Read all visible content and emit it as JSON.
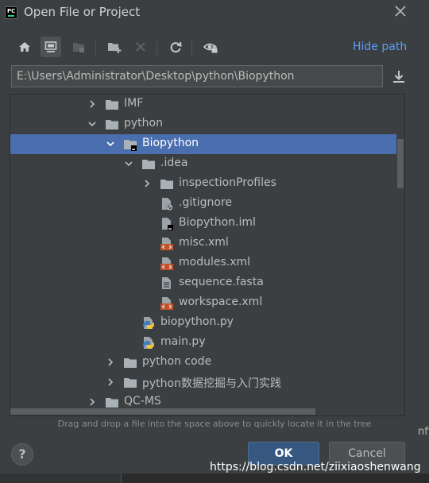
{
  "window": {
    "title": "Open File or Project"
  },
  "toolbar": {
    "buttons": [
      "home-icon",
      "desktop-icon",
      "project-icon",
      "new-folder-icon",
      "delete-icon",
      "refresh-icon",
      "show-hidden-icon"
    ],
    "hide_path_label": "Hide path"
  },
  "path": {
    "value": "E:\\Users\\Administrator\\Desktop\\python\\Biopython"
  },
  "tree": {
    "items": [
      {
        "label": "IMF",
        "icon": "folder-icon",
        "arrow": "right",
        "indent": 0,
        "selected": false
      },
      {
        "label": "python",
        "icon": "folder-icon",
        "arrow": "down",
        "indent": 0,
        "selected": false
      },
      {
        "label": "Biopython",
        "icon": "project-folder-icon",
        "arrow": "down",
        "indent": 1,
        "selected": true
      },
      {
        "label": ".idea",
        "icon": "folder-icon",
        "arrow": "down",
        "indent": 2,
        "selected": false
      },
      {
        "label": "inspectionProfiles",
        "icon": "folder-icon",
        "arrow": "right",
        "indent": 3,
        "selected": false
      },
      {
        "label": ".gitignore",
        "icon": "ignore-file-icon",
        "arrow": "none",
        "indent": 3,
        "selected": false
      },
      {
        "label": "Biopython.iml",
        "icon": "iml-file-icon",
        "arrow": "none",
        "indent": 3,
        "selected": false
      },
      {
        "label": "misc.xml",
        "icon": "xml-file-icon",
        "arrow": "none",
        "indent": 3,
        "selected": false
      },
      {
        "label": "modules.xml",
        "icon": "xml-file-icon",
        "arrow": "none",
        "indent": 3,
        "selected": false
      },
      {
        "label": "sequence.fasta",
        "icon": "text-file-icon",
        "arrow": "none",
        "indent": 3,
        "selected": false
      },
      {
        "label": "workspace.xml",
        "icon": "xml-file-icon",
        "arrow": "none",
        "indent": 3,
        "selected": false
      },
      {
        "label": "biopython.py",
        "icon": "python-file-icon",
        "arrow": "none",
        "indent": 2,
        "selected": false
      },
      {
        "label": "main.py",
        "icon": "python-file-icon",
        "arrow": "none",
        "indent": 2,
        "selected": false
      },
      {
        "label": "python code",
        "icon": "folder-icon",
        "arrow": "right",
        "indent": 1,
        "selected": false
      },
      {
        "label": "python数据挖掘与入门实践",
        "icon": "folder-icon",
        "arrow": "right",
        "indent": 1,
        "selected": false
      },
      {
        "label": "QC-MS",
        "icon": "folder-icon",
        "arrow": "right",
        "indent": 0,
        "selected": false
      }
    ]
  },
  "hint": "Drag and drop a file into the space above to quickly locate it in the tree",
  "buttons": {
    "help": "?",
    "ok": "OK",
    "cancel": "Cancel"
  },
  "side_fragment": "nfi",
  "watermark": "https://blog.csdn.net/ziixiaoshenwang",
  "colors": {
    "background": "#3c3f41",
    "selection": "#4b6eaf",
    "link": "#589df6",
    "ok_button": "#365880"
  }
}
